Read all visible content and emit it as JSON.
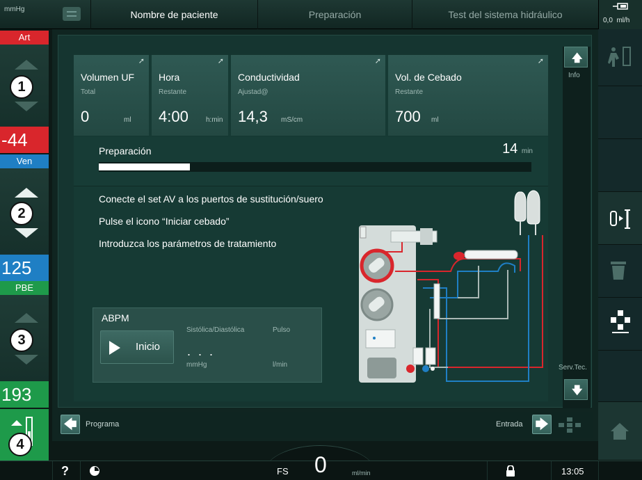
{
  "topbar": {
    "pressure_unit": "mmHg",
    "tabs": [
      {
        "label": "Nombre de paciente"
      },
      {
        "label": "Preparación"
      },
      {
        "label": "Test del sistema hidráulico"
      }
    ],
    "uf_rate": {
      "value": "0,0",
      "unit": "ml/h"
    }
  },
  "left": {
    "art_label": "Art",
    "art_value": "-44",
    "ven_label": "Ven",
    "ven_value": "125",
    "pbe_label": "PBE",
    "pbe_value": "193",
    "markers": [
      "1",
      "2",
      "3",
      "4"
    ]
  },
  "tiles": [
    {
      "title": "Volumen UF",
      "sub": "Total",
      "value": "0",
      "unit": "ml"
    },
    {
      "title": "Hora",
      "sub": "Restante",
      "value": "4:00",
      "unit": "h:min"
    },
    {
      "title": "Conductividad",
      "sub": "Ajustad@",
      "value": "14,3",
      "unit": "mS/cm"
    },
    {
      "title": "Vol. de Cebado",
      "sub": "Restante",
      "value": "700",
      "unit": "ml"
    }
  ],
  "progress": {
    "label": "Preparación",
    "remaining": "14",
    "remaining_unit": "min",
    "fraction": 0.21
  },
  "instructions": [
    "Conecte el set AV a los puertos de sustitución/suero",
    "Pulse el icono “Iniciar cebado”",
    "Introduzca los parámetros de tratamiento"
  ],
  "abpm": {
    "title": "ABPM",
    "start_label": "Inicio",
    "sys_dia_label": "Sistólica/Diastólica",
    "pulse_label": "Pulso",
    "value_placeholder": ". . .",
    "unit_mmhg": "mmHg",
    "unit_pulse": "l/min"
  },
  "rail": {
    "info_label": "Info",
    "service_label": "Serv.Tec."
  },
  "bottom_nav": {
    "back_label": "Programa",
    "next_label": "Entrada"
  },
  "status": {
    "help": "?",
    "fs_label": "FS",
    "fs_value": "0",
    "fs_unit": "ml/min",
    "time": "13:05"
  },
  "colors": {
    "art_red": "#d9262c",
    "ven_blue": "#1f7fc4",
    "pbe_green": "#1e9a4a",
    "accent_green": "#2f5953"
  },
  "icons": [
    "menu-icon",
    "pressure-unit",
    "uf-rate-icon",
    "up-arrow-icon",
    "down-arrow-icon",
    "patient-on-machine-icon",
    "connect-icon",
    "filter-icon",
    "settings-tree-icon",
    "home-icon",
    "help-icon",
    "clock-icon",
    "lock-icon",
    "left-arrow-icon",
    "right-arrow-icon"
  ]
}
